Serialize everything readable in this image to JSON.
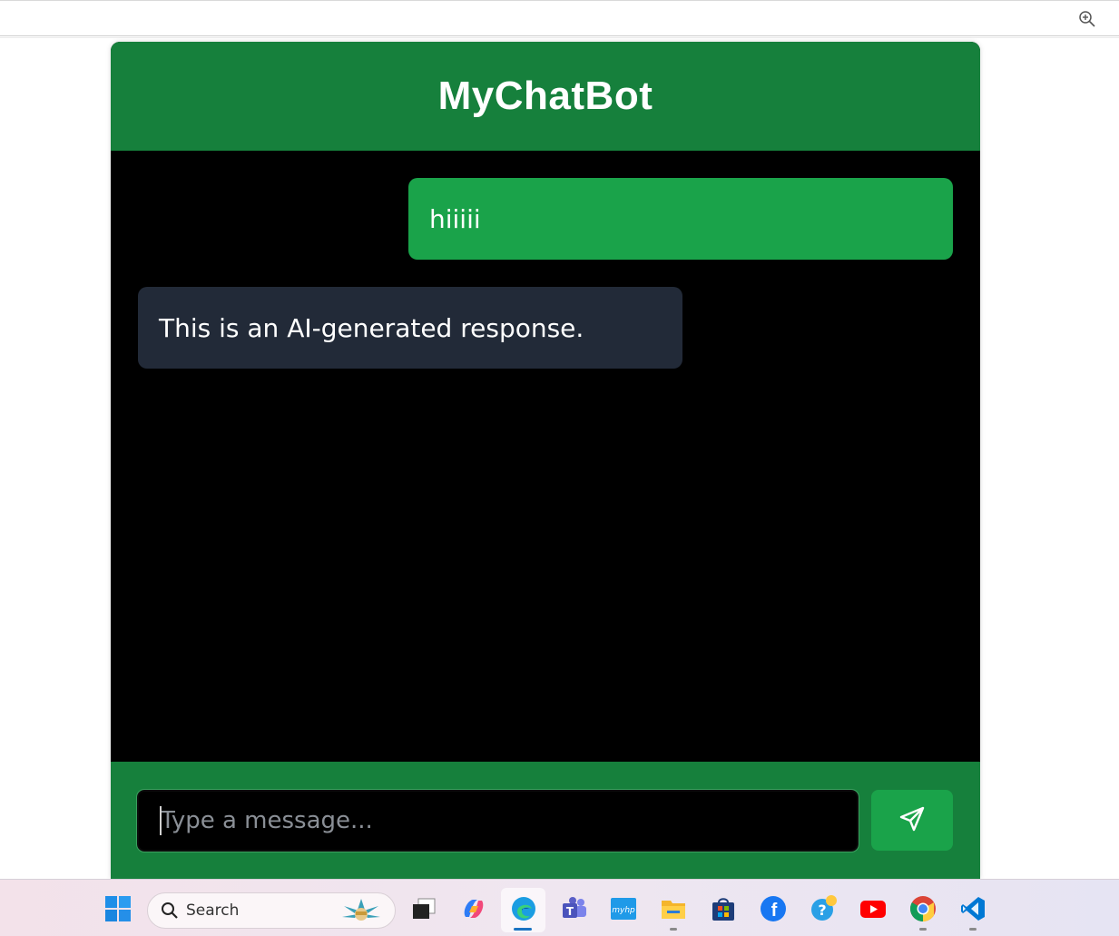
{
  "app": {
    "title": "MyChatBot"
  },
  "messages": [
    {
      "role": "user",
      "text": "hiiiii"
    },
    {
      "role": "bot",
      "text": "This is an AI-generated response."
    }
  ],
  "composer": {
    "placeholder": "Type a message...",
    "value": ""
  },
  "taskbar": {
    "search_label": "Search",
    "apps": [
      "windows-start",
      "task-view",
      "copilot",
      "edge",
      "teams",
      "myhp",
      "file-explorer",
      "microsoft-store",
      "facebook",
      "help",
      "youtube",
      "chrome",
      "vscode"
    ]
  },
  "colors": {
    "header_green": "#16803c",
    "user_bubble": "#1aa34a",
    "bot_bubble": "#222a38",
    "chat_background": "#000000"
  }
}
